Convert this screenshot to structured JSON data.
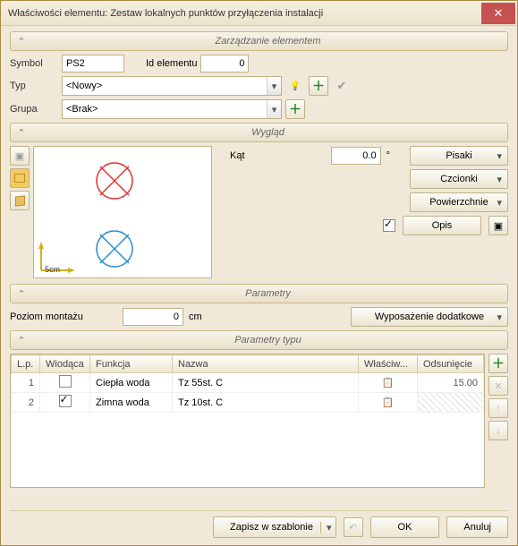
{
  "window": {
    "title": "Właściwości elementu: Zestaw lokalnych punktów przyłączenia instalacji"
  },
  "sections": {
    "manage": "Zarządzanie elementem",
    "appearance": "Wygląd",
    "params": "Parametry",
    "type_params": "Parametry typu"
  },
  "manage": {
    "symbol_label": "Symbol",
    "symbol_value": "PS2",
    "id_label": "Id elementu",
    "id_value": "0",
    "type_label": "Typ",
    "type_value": "<Nowy>",
    "group_label": "Grupa",
    "group_value": "<Brak>"
  },
  "appearance": {
    "angle_label": "Kąt",
    "angle_value": "0.0",
    "angle_unit": "°",
    "btn_pens": "Pisaki",
    "btn_fonts": "Czcionki",
    "btn_surfaces": "Powierzchnie",
    "btn_desc": "Opis",
    "scale": "5cm"
  },
  "params": {
    "mount_label": "Poziom montażu",
    "mount_value": "0",
    "mount_unit": "cm",
    "extra_label": "Wyposażenie dodatkowe"
  },
  "type_params": {
    "headers": {
      "lp": "L.p.",
      "wiodaca": "Wiodąca",
      "funkcja": "Funkcja",
      "nazwa": "Nazwa",
      "wlasciw": "Właściw...",
      "odsuniecie": "Odsunięcie"
    },
    "rows": [
      {
        "lp": "1",
        "wiodaca": false,
        "funkcja": "Ciepła woda",
        "nazwa": "Tz 55st. C",
        "odsuniecie": "15.00"
      },
      {
        "lp": "2",
        "wiodaca": true,
        "funkcja": "Zimna woda",
        "nazwa": "Tz 10st. C",
        "odsuniecie": ""
      }
    ]
  },
  "buttons": {
    "save_template": "Zapisz w szablonie",
    "ok": "OK",
    "cancel": "Anuluj"
  },
  "colors": {
    "accent_red": "#e03030",
    "accent_blue": "#2a8cd0",
    "accent_green": "#2a8c2a",
    "accent_gold": "#f5cb5c"
  }
}
